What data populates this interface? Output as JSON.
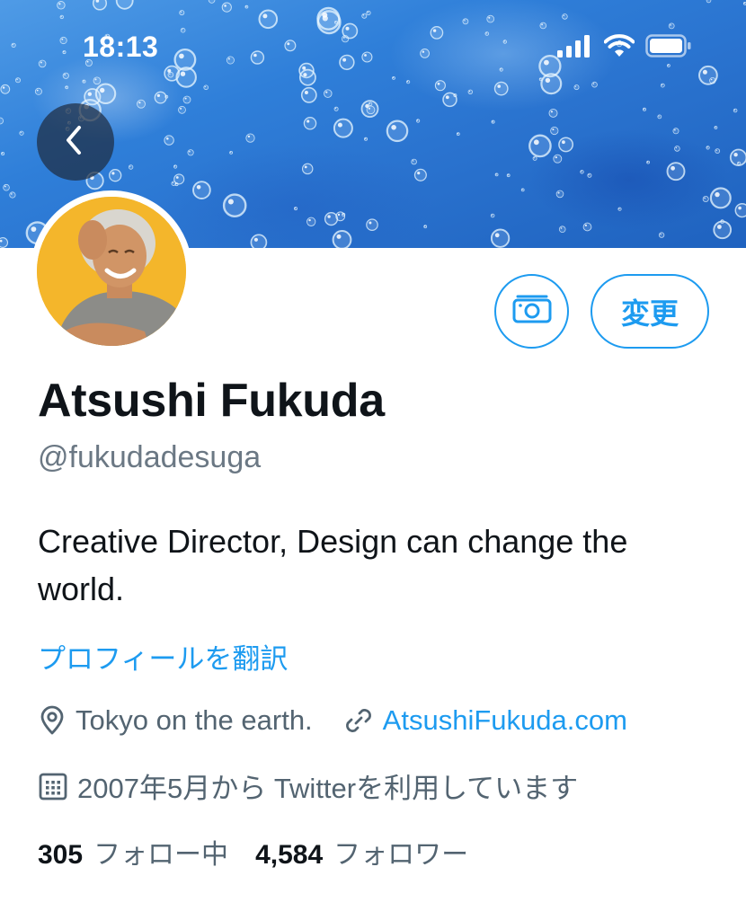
{
  "status_bar": {
    "time": "18:13"
  },
  "profile": {
    "display_name": "Atsushi Fukuda",
    "handle": "@fukudadesuga",
    "bio": "Creative Director, Design can change the world.",
    "translate_label": "プロフィールを翻訳",
    "location": "Tokyo on the earth.",
    "website": "AtsushiFukuda.com",
    "joined": "2007年5月から Twitterを利用しています",
    "following_count": "305",
    "following_label": "フォロー中",
    "followers_count": "4,584",
    "followers_label": "フォロワー"
  },
  "actions": {
    "edit_label": "変更"
  },
  "icons": {
    "back": "chevron-left-icon",
    "camera": "camera-icon",
    "location": "location-pin-icon",
    "link": "link-icon",
    "calendar": "calendar-icon",
    "signal": "signal-icon",
    "wifi": "wifi-icon",
    "battery": "battery-icon"
  },
  "colors": {
    "accent": "#1d9bf0",
    "text_primary": "#0f1419",
    "text_secondary": "#536471",
    "banner": "#2f7fd9"
  }
}
